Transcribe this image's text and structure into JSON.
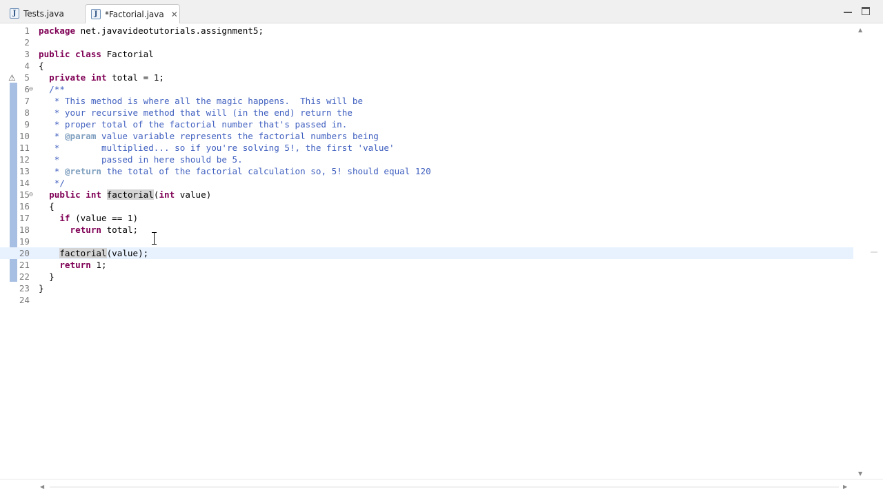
{
  "tabs": [
    {
      "label": "Tests.java",
      "icon": "java-file-icon",
      "active": false
    },
    {
      "label": "*Factorial.java",
      "icon": "java-file-icon",
      "active": true,
      "close": "✕"
    }
  ],
  "editor": {
    "current_line": 20,
    "lines": [
      {
        "n": "1",
        "text": "package net.javavideotutorials.assignment5;"
      },
      {
        "n": "2",
        "text": ""
      },
      {
        "n": "3",
        "text": "public class Factorial"
      },
      {
        "n": "4",
        "text": "{"
      },
      {
        "n": "5",
        "text": "  private int total = 1;"
      },
      {
        "n": "6",
        "text": "  /**"
      },
      {
        "n": "7",
        "text": "   * This method is where all the magic happens.  This will be"
      },
      {
        "n": "8",
        "text": "   * your recursive method that will (in the end) return the"
      },
      {
        "n": "9",
        "text": "   * proper total of the factorial number that's passed in."
      },
      {
        "n": "10",
        "text": "   * @param value variable represents the factorial numbers being"
      },
      {
        "n": "11",
        "text": "   *        multiplied... so if you're solving 5!, the first 'value'"
      },
      {
        "n": "12",
        "text": "   *        passed in here should be 5."
      },
      {
        "n": "13",
        "text": "   * @return the total of the factorial calculation so, 5! should equal 120"
      },
      {
        "n": "14",
        "text": "   */"
      },
      {
        "n": "15",
        "text": "  public int factorial(int value)"
      },
      {
        "n": "16",
        "text": "  {"
      },
      {
        "n": "17",
        "text": "    if (value == 1)"
      },
      {
        "n": "18",
        "text": "      return total;"
      },
      {
        "n": "19",
        "text": ""
      },
      {
        "n": "20",
        "text": "    factorial(value);"
      },
      {
        "n": "21",
        "text": "    return 1;"
      },
      {
        "n": "22",
        "text": "  }"
      },
      {
        "n": "23",
        "text": "}"
      },
      {
        "n": "24",
        "text": ""
      }
    ]
  },
  "colors": {
    "keyword": "#7f0055",
    "javadoc": "#3f5fbf",
    "javadoc_tag": "#7f9fbf",
    "current_line": "#e8f2fe",
    "change_bar": "#a7bfe2"
  },
  "icons": {
    "warning": "warning-icon",
    "fold": "fold-collapse-icon"
  }
}
